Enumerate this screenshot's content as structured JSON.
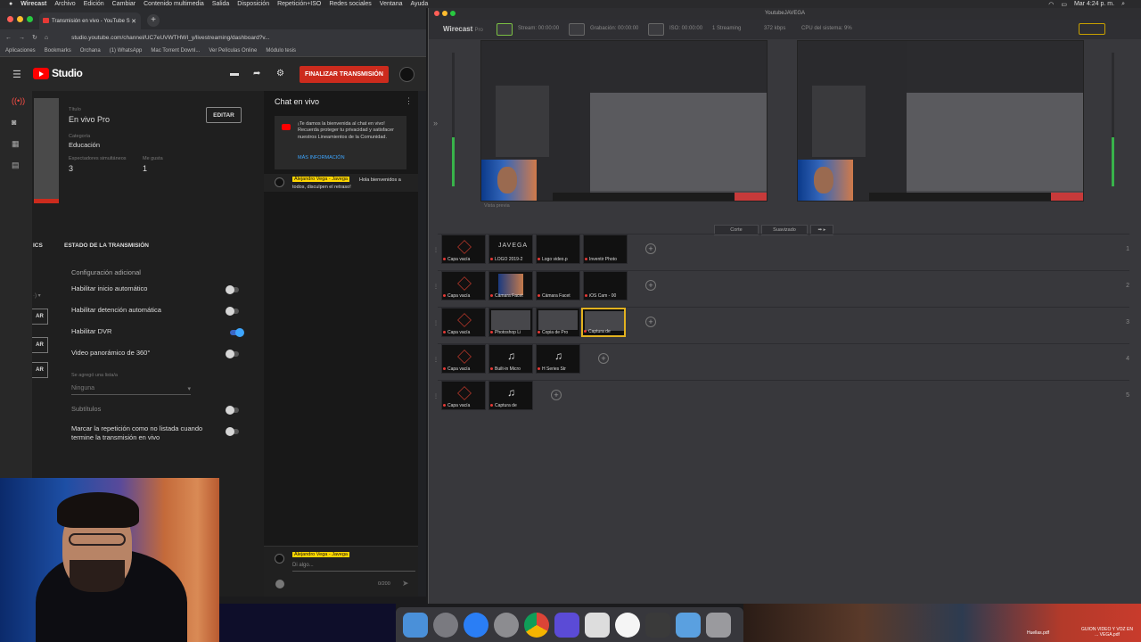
{
  "menubar": {
    "app": "Wirecast",
    "items": [
      "Archivo",
      "Edición",
      "Cambiar",
      "Contenido multimedia",
      "Salida",
      "Disposición",
      "Repetición+ISO",
      "Redes sociales",
      "Ventana",
      "Ayuda"
    ],
    "clock": "Mar 4:24 p. m."
  },
  "chrome": {
    "tab_title": "Transmisión en vivo - YouTube S",
    "url": "studio.youtube.com/channel/UC7eUVWTHWI_y/livestreaming/dashboard?v...",
    "bookmarks": [
      "Aplicaciones",
      "Bookmarks",
      "Orchana",
      "(1) WhatsApp",
      "Mac Torrent Downl...",
      "Ver Películas Online",
      "Módulo tesis"
    ]
  },
  "studio": {
    "logo_text": "Studio",
    "end_button": "FINALIZAR TRANSMISIÓN",
    "title_label": "Título",
    "title_value": "En vivo Pro",
    "edit_button": "EDITAR",
    "category_label": "Categoría",
    "category_value": "Educación",
    "viewers_label": "Espectadores simultáneos",
    "viewers_value": "3",
    "likes_label": "Me gusta",
    "likes_value": "1",
    "section_cut": "ICS",
    "section_title": "ESTADO DE LA TRANSMISIÓN",
    "config_heading": "Configuración adicional",
    "settings": [
      {
        "label": "Habilitar inicio automático",
        "on": false
      },
      {
        "label": "Habilitar detención automática",
        "on": false
      },
      {
        "label": "Habilitar DVR",
        "on": true
      },
      {
        "label": "Video panorámico de 360°",
        "on": false
      }
    ],
    "side_buttons": [
      "AR",
      "AR",
      "AR"
    ],
    "playlist_label": "Se agregó una lista/a",
    "playlist_value": "Ninguna",
    "subtitles": "Subtítulos",
    "unlisted": "Marcar la repetición como no listada cuando termine la transmisión en vivo"
  },
  "chat": {
    "title": "Chat en vivo",
    "notice": "¡Te damos la bienvenida al chat en vivo! Recuerda proteger tu privacidad y satisfacer nuestros Lineamientos de la Comunidad.",
    "more_info": "MÁS INFORMACIÓN",
    "message_author": "Alejandro Vega - Javega",
    "message_text": "Hola bienvenidos a todos, disculpen el retraso!",
    "input_author": "Alejandro Vega - Javega",
    "input_placeholder": "Di algo...",
    "char_count": "0/200"
  },
  "wirecast": {
    "window_title": "YoutubeJAVEGA",
    "logo": "Wirecast",
    "logo_sub": "Pro",
    "stats": [
      "Stream: 00:00:00",
      "Grabación: 00:00:00",
      "ISO: 00:00:00",
      "1 Streaming",
      "372 kbps",
      "CPU del sistema: 9%"
    ],
    "preview_label": "Vista previa",
    "transition_cut": "Corte",
    "transition_smooth": "Suavizado",
    "layers": [
      {
        "num": "1",
        "shots": [
          "Capa vacía",
          "LOGO 2019-2",
          "Logo video.p",
          "Inventir Photo"
        ]
      },
      {
        "num": "2",
        "shots": [
          "Capa vacía",
          "Cámara Facet",
          "Cámara Facet",
          "iOS Cam - 00"
        ]
      },
      {
        "num": "3",
        "shots": [
          "Capa vacía",
          "Photoshop Li",
          "Copia de Pro",
          "Captura de"
        ]
      },
      {
        "num": "4",
        "shots": [
          "Capa vacía",
          "Built-in Micro",
          "H Series Str"
        ]
      },
      {
        "num": "5",
        "shots": [
          "Capa vacía",
          "Captura de"
        ]
      }
    ],
    "jvega_logo": "JAVEGA"
  },
  "desktop": {
    "file1": "Huellas.pdf",
    "file2": "GUION VIDEO Y VOZ EN ... VEGA.pdf"
  }
}
